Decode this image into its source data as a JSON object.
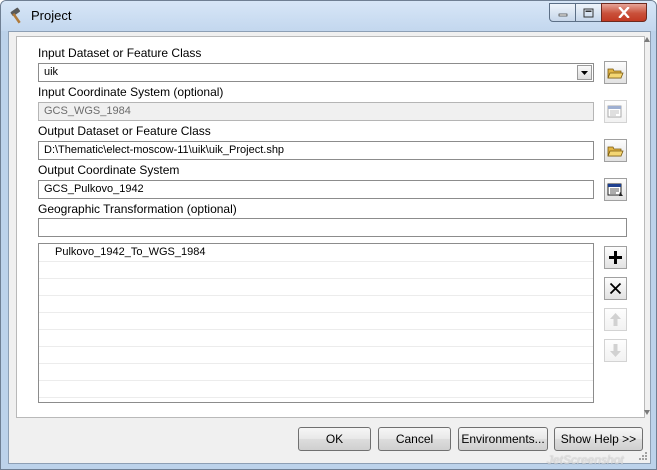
{
  "window": {
    "title": "Project",
    "icon": "hammer-icon",
    "controls": [
      "minimize-icon",
      "maximize-icon",
      "close-icon"
    ]
  },
  "form": {
    "input_dataset": {
      "label": "Input Dataset or Feature Class",
      "value": "uik"
    },
    "input_coord_system": {
      "label": "Input Coordinate System (optional)",
      "value": "GCS_WGS_1984"
    },
    "output_dataset": {
      "label": "Output Dataset or Feature Class",
      "value": "D:\\Thematic\\elect-moscow-11\\uik\\uik_Project.shp"
    },
    "output_coord_system": {
      "label": "Output Coordinate System",
      "value": "GCS_Pulkovo_1942"
    },
    "geo_transformation": {
      "label": "Geographic Transformation (optional)",
      "value": "",
      "items": [
        "Pulkovo_1942_To_WGS_1984"
      ]
    }
  },
  "buttons": {
    "ok": "OK",
    "cancel": "Cancel",
    "environments": "Environments...",
    "show_help": "Show Help >>"
  },
  "watermark": "JetScreenshot",
  "colors": {
    "frame": "#bcd2ea",
    "close_button": "#c9503a",
    "folder_icon": "#e2b545"
  }
}
